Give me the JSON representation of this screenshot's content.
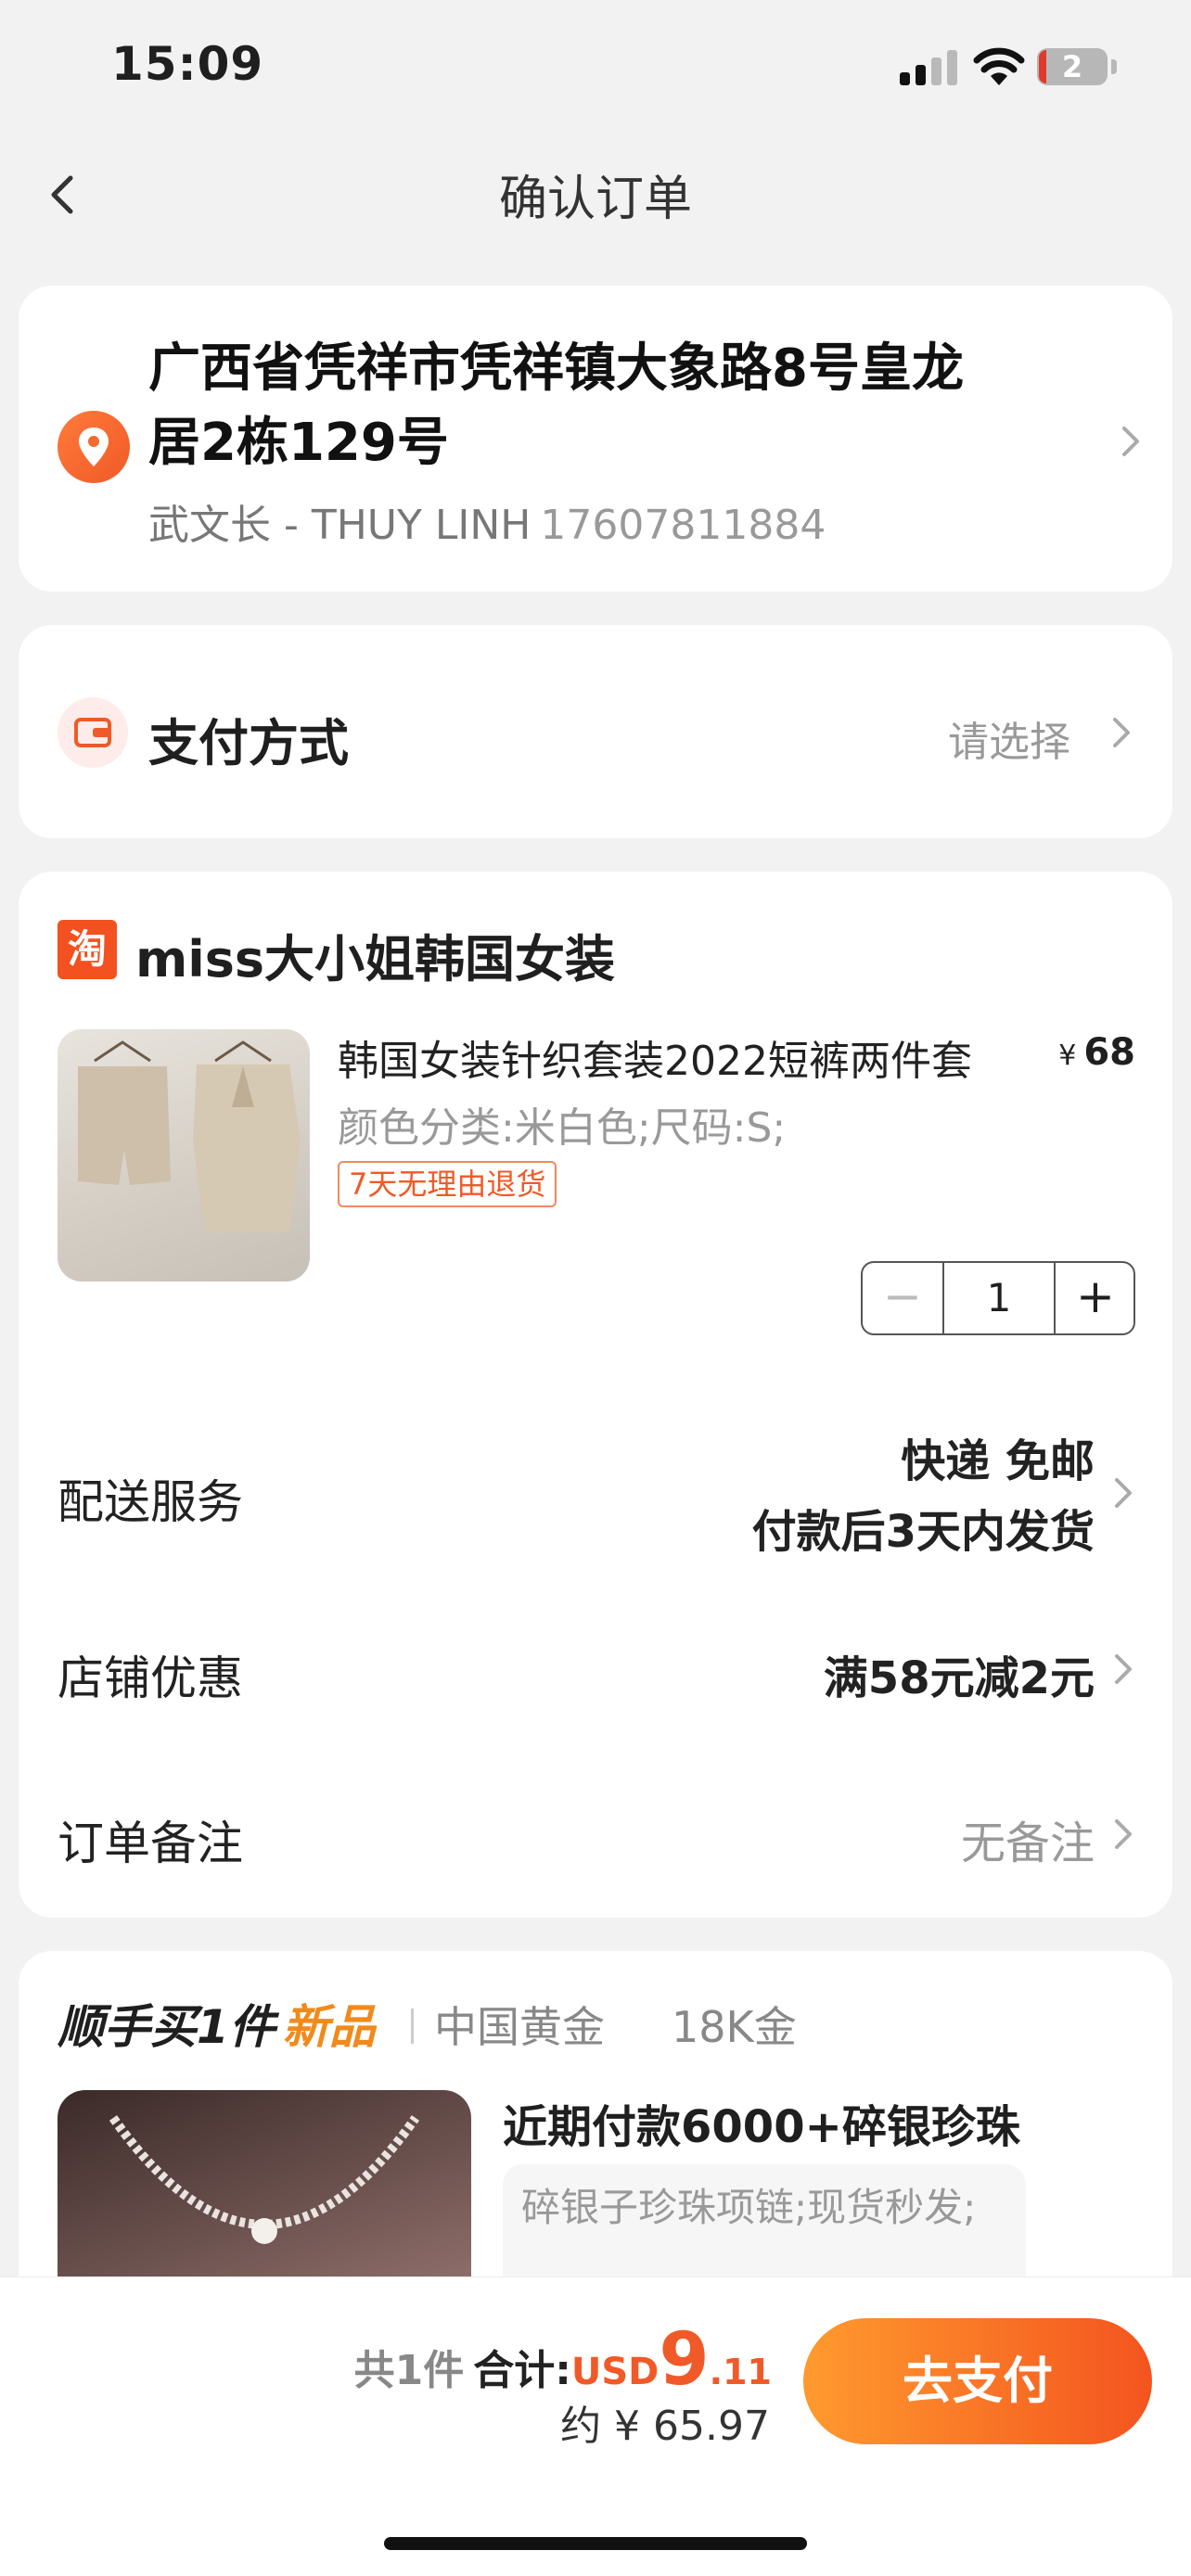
{
  "status_bar": {
    "time": "15:09",
    "battery": "2"
  },
  "nav": {
    "title": "确认订单"
  },
  "address": {
    "line1": "广西省凭祥市凭祥镇大象路8号皇龙",
    "line2": "居2栋129号",
    "contact": "武文长 - THUY LINH",
    "phone": "17607811884"
  },
  "payment": {
    "label": "支付方式",
    "value": "请选择"
  },
  "shop": {
    "logo_text": "淘",
    "name": "miss大小姐韩国女装"
  },
  "product": {
    "title": "韩国女装针织套装2022短裤两件套",
    "price_symbol": "¥",
    "price": "68",
    "spec": "颜色分类:米白色;尺码:S;",
    "return_tag": "7天无理由退货",
    "quantity": "1",
    "minus": "−",
    "plus": "+"
  },
  "delivery": {
    "label": "配送服务",
    "line1": "快递 免邮",
    "line2": "付款后3天内发货"
  },
  "discount": {
    "label": "店铺优惠",
    "value": "满58元减2元"
  },
  "note": {
    "label": "订单备注",
    "value": "无备注"
  },
  "recommend": {
    "head": "顺手买1件",
    "badge": "新品",
    "tags": [
      "中国黄金",
      "18K金"
    ],
    "title": "近期付款6000+碎银珍珠",
    "desc": "碎银子珍珠项链;现货秒发;"
  },
  "bottom": {
    "count": "共1件",
    "total_label": "合计:",
    "currency": "USD",
    "amount_int": "9",
    "amount_dec": ".11",
    "approx": "约 ¥ 65.97",
    "pay_button": "去支付"
  },
  "colors": {
    "accent": "#f05a28",
    "accent_light": "#ff9a2e",
    "background": "#f2f2f2"
  }
}
